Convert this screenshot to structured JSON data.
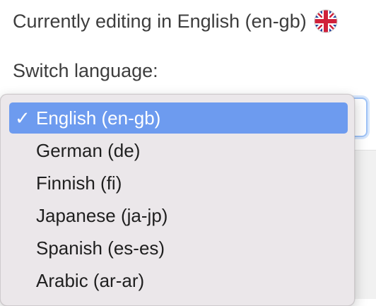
{
  "header": {
    "editing_text": "Currently editing in English (en-gb)",
    "flag_icon": "uk-flag-icon"
  },
  "switcher": {
    "label": "Switch language:",
    "selected_value": "English (en-gb)",
    "check_mark": "✓",
    "options": [
      {
        "label": "English (en-gb)",
        "selected": true
      },
      {
        "label": "German (de)",
        "selected": false
      },
      {
        "label": "Finnish (fi)",
        "selected": false
      },
      {
        "label": "Japanese (ja-jp)",
        "selected": false
      },
      {
        "label": "Spanish (es-es)",
        "selected": false
      },
      {
        "label": "Arabic (ar-ar)",
        "selected": false
      }
    ]
  },
  "colors": {
    "selected_bg": "#6d9bef",
    "dropdown_bg": "#ebe7ea",
    "focus_ring": "#9ec2f6"
  }
}
